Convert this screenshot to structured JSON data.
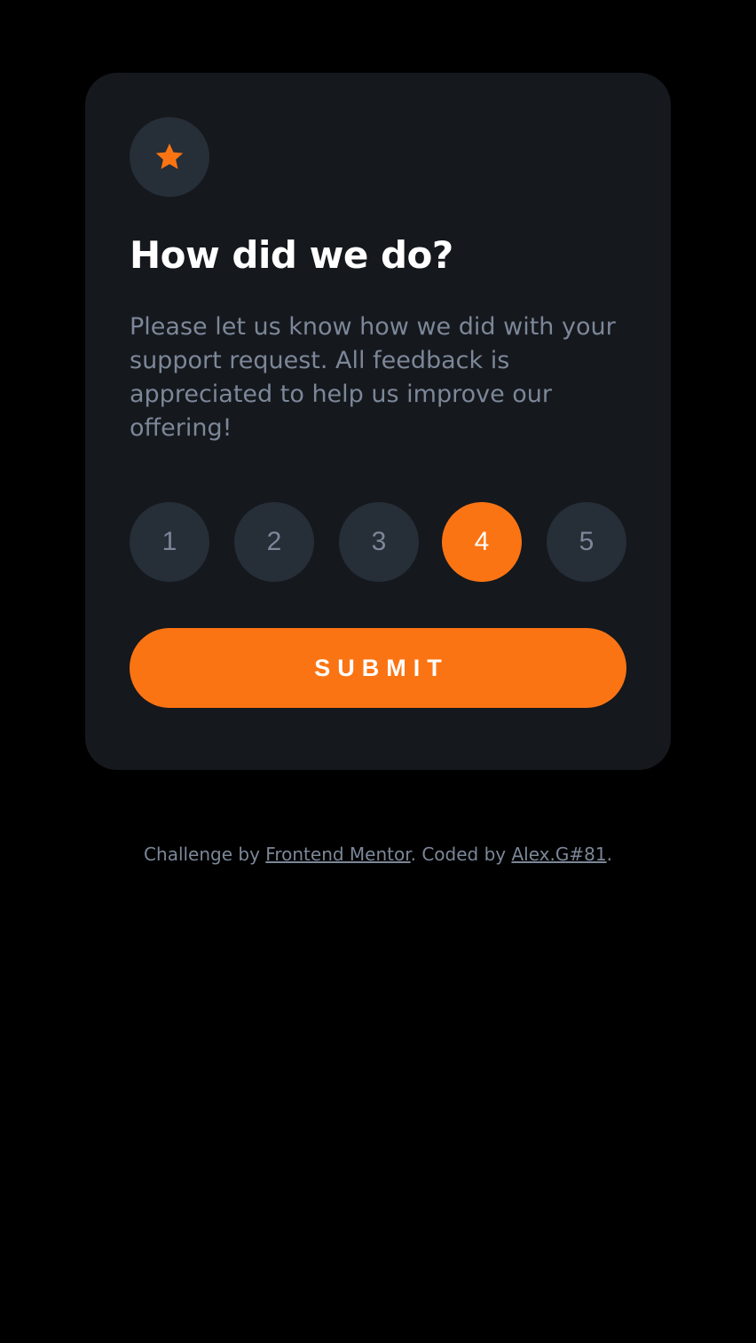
{
  "card": {
    "icon": "star-icon",
    "title": "How did we do?",
    "description": "Please let us know how we did with your support request. All feedback is appreciated to help us improve our offering!",
    "ratings": [
      {
        "label": "1",
        "selected": false
      },
      {
        "label": "2",
        "selected": false
      },
      {
        "label": "3",
        "selected": false
      },
      {
        "label": "4",
        "selected": true
      },
      {
        "label": "5",
        "selected": false
      }
    ],
    "submit_label": "SUBMIT"
  },
  "attribution": {
    "prefix": "Challenge by ",
    "link1_text": "Frontend Mentor",
    "middle": ". Coded by ",
    "link2_text": "Alex.G#81",
    "suffix": "."
  },
  "colors": {
    "page_bg": "#000000",
    "card_bg": "#15181d",
    "circle_bg": "#262e38",
    "accent": "#fb7413",
    "muted_text": "#7c8798",
    "white": "#ffffff"
  }
}
